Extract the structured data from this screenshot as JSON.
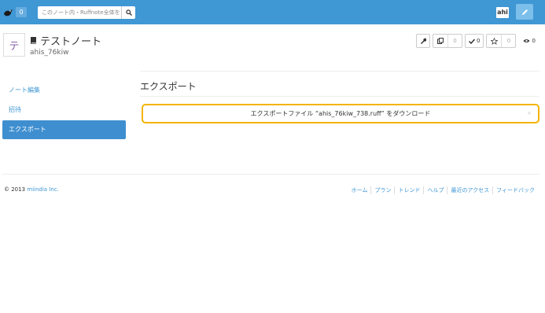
{
  "topbar": {
    "notification_count": "0",
    "search_placeholder": "このノート内・Ruffnote全体を検索",
    "user_avatar": "ahi"
  },
  "note": {
    "icon_char": "テ",
    "title": "テストノート",
    "owner": "ahis_76kiw"
  },
  "actions": {
    "copy_count": "0",
    "check_count": "0",
    "star_count": "0",
    "view_count": "0"
  },
  "sidebar": {
    "items": [
      {
        "label": "ノート編集"
      },
      {
        "label": "招待"
      },
      {
        "label": "エクスポート"
      }
    ]
  },
  "main": {
    "section_title": "エクスポート",
    "download_label": "エクスポートファイル “ahis_76kiw_738.ruff” をダウンロード"
  },
  "footer": {
    "copyright": "© 2013 ",
    "company": "miindia Inc.",
    "links": [
      "ホーム",
      "プラン",
      "トレンド",
      "ヘルプ",
      "最近のアクセス",
      "フィードバック"
    ]
  },
  "colors": {
    "topbar": "#3f97d4",
    "active_sidebar": "#3f8fd0",
    "highlight_border": "#f4b400",
    "link": "#3f97d4"
  }
}
